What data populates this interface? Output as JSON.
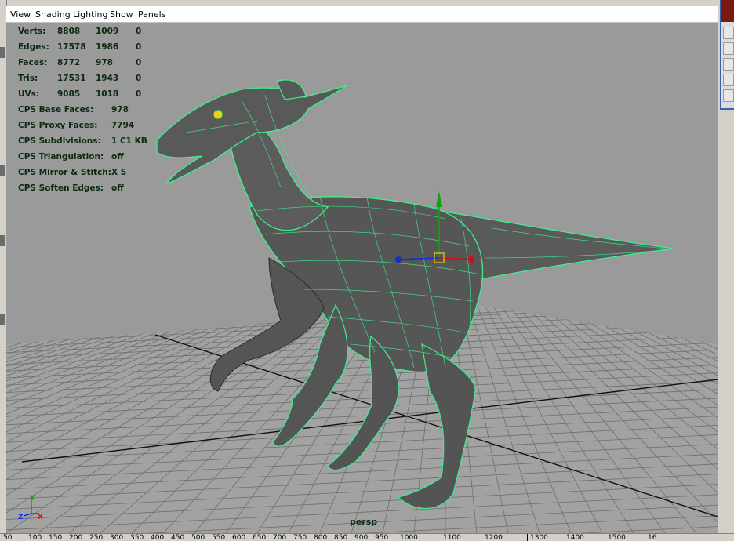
{
  "menu": {
    "items": [
      "View",
      "Shading",
      "Lighting",
      "Show",
      "Panels"
    ]
  },
  "hud": {
    "stats": [
      {
        "label": "Verts:",
        "v1": "8808",
        "v2": "1009",
        "v3": "0"
      },
      {
        "label": "Edges:",
        "v1": "17578",
        "v2": "1986",
        "v3": "0"
      },
      {
        "label": "Faces:",
        "v1": "8772",
        "v2": "978",
        "v3": "0"
      },
      {
        "label": "Tris:",
        "v1": "17531",
        "v2": "1943",
        "v3": "0"
      },
      {
        "label": "UVs:",
        "v1": "9085",
        "v2": "1018",
        "v3": "0"
      }
    ],
    "cps": [
      {
        "label": "CPS Base Faces:",
        "value": "978"
      },
      {
        "label": "CPS Proxy Faces:",
        "value": "7794"
      },
      {
        "label": "CPS Subdivisions:",
        "value": "1 C1 KB"
      },
      {
        "label": "CPS Triangulation:",
        "value": "off"
      },
      {
        "label": "CPS Mirror & Stitch:",
        "value": "X S"
      },
      {
        "label": "CPS Soften Edges:",
        "value": "off"
      }
    ]
  },
  "viewport": {
    "camera_name": "persp",
    "axis_labels": {
      "x": "X",
      "y": "Y",
      "z": "Z"
    }
  },
  "timeslider": {
    "ticks": [
      "50",
      "100",
      "150",
      "200",
      "250",
      "300",
      "350",
      "400",
      "450",
      "500",
      "550",
      "600",
      "650",
      "700",
      "750",
      "800",
      "850",
      "900",
      "950",
      "1000",
      "1100",
      "1200",
      "1300",
      "1400",
      "1500",
      "16"
    ]
  },
  "colors": {
    "viewport_bg": "#9a9a9a",
    "grid": "#6e6e6e",
    "wire": "#3cf08c",
    "mesh": "#5a5a5a",
    "hud_text": "#0b2a0f",
    "manip_x": "#d01010",
    "manip_y": "#10a010",
    "manip_z": "#1030d0"
  }
}
